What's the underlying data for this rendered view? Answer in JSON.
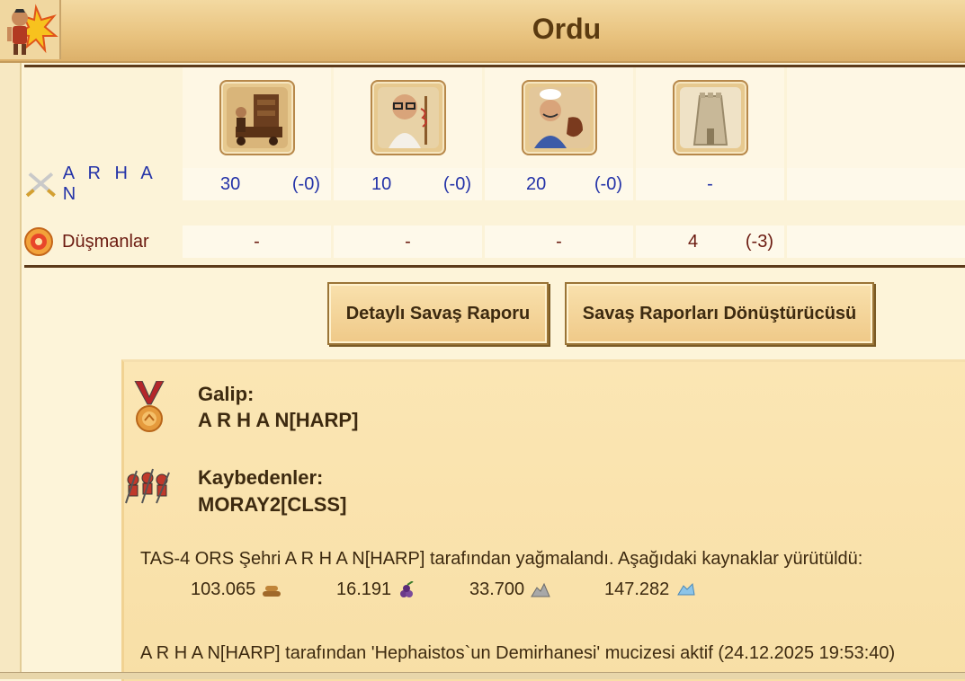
{
  "header": {
    "title": "Ordu",
    "icon": "warrior-explosion-icon"
  },
  "units": [
    {
      "name": "siege-engine-unit-icon"
    },
    {
      "name": "doctor-unit-icon"
    },
    {
      "name": "cook-unit-icon"
    },
    {
      "name": "wall-unit-icon"
    }
  ],
  "attacker": {
    "name": "A R H A N",
    "icon": "crossed-swords-icon",
    "values": [
      {
        "value": "30",
        "diff": "(-0)"
      },
      {
        "value": "10",
        "diff": "(-0)"
      },
      {
        "value": "20",
        "diff": "(-0)"
      },
      {
        "value": "-"
      }
    ]
  },
  "defender": {
    "name": "Düşmanlar",
    "icon": "target-icon",
    "values": [
      {
        "value": "-"
      },
      {
        "value": "-"
      },
      {
        "value": "-"
      },
      {
        "value": "4",
        "diff": "(-3)"
      }
    ]
  },
  "buttons": {
    "detailed_report": "Detaylı Savaş Raporu",
    "report_converter": "Savaş Raporları Dönüştürücüsü"
  },
  "report": {
    "winner_label": "Galip:",
    "winner_name": "A R H A N[HARP]",
    "losers_label": "Kaybedenler:",
    "loser_name": "MORAY2[CLSS]",
    "plunder_text": "TAS-4 ORS Şehri A R H A N[HARP] tarafından yağmalandı. Aşağıdaki kaynaklar yürütüldü:",
    "resources": [
      {
        "amount": "103.065",
        "icon": "wood-icon"
      },
      {
        "amount": "16.191",
        "icon": "wine-icon"
      },
      {
        "amount": "33.700",
        "icon": "marble-icon"
      },
      {
        "amount": "147.282",
        "icon": "crystal-icon"
      }
    ],
    "wonder_text": "A R H A N[HARP] tarafından 'Hephaistos`un Demirhanesi' mucizesi aktif (24.12.2025 19:53:40)"
  },
  "colors": {
    "attacker": "#2433a8",
    "defender": "#6b1a10",
    "border": "#5c3a1a"
  }
}
